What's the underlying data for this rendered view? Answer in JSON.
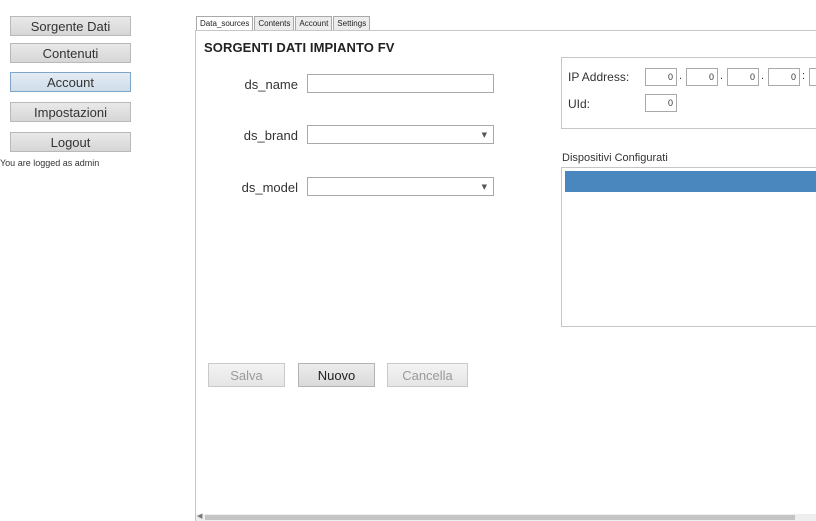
{
  "sidebar": {
    "items": [
      {
        "label": "Sorgente Dati"
      },
      {
        "label": "Contenuti"
      },
      {
        "label": "Account"
      },
      {
        "label": "Impostazioni"
      },
      {
        "label": "Logout"
      }
    ],
    "logged_text": "You are logged as admin"
  },
  "tabs": [
    {
      "label": "Data_sources"
    },
    {
      "label": "Contents"
    },
    {
      "label": "Account"
    },
    {
      "label": "Settings"
    }
  ],
  "main": {
    "title": "SORGENTI DATI IMPIANTO FV",
    "fields": {
      "name_label": "ds_name",
      "name_value": "",
      "brand_label": "ds_brand",
      "brand_value": "",
      "model_label": "ds_model",
      "model_value": ""
    },
    "ip": {
      "label": "IP Address:",
      "octets": [
        "0",
        "0",
        "0",
        "0"
      ],
      "uid_label": "UId:",
      "uid_value": "0"
    },
    "devices_title": "Dispositivi Configurati",
    "buttons": {
      "save": "Salva",
      "new": "Nuovo",
      "cancel": "Cancella"
    }
  },
  "colors": {
    "selected_row": "#4a87bf"
  }
}
